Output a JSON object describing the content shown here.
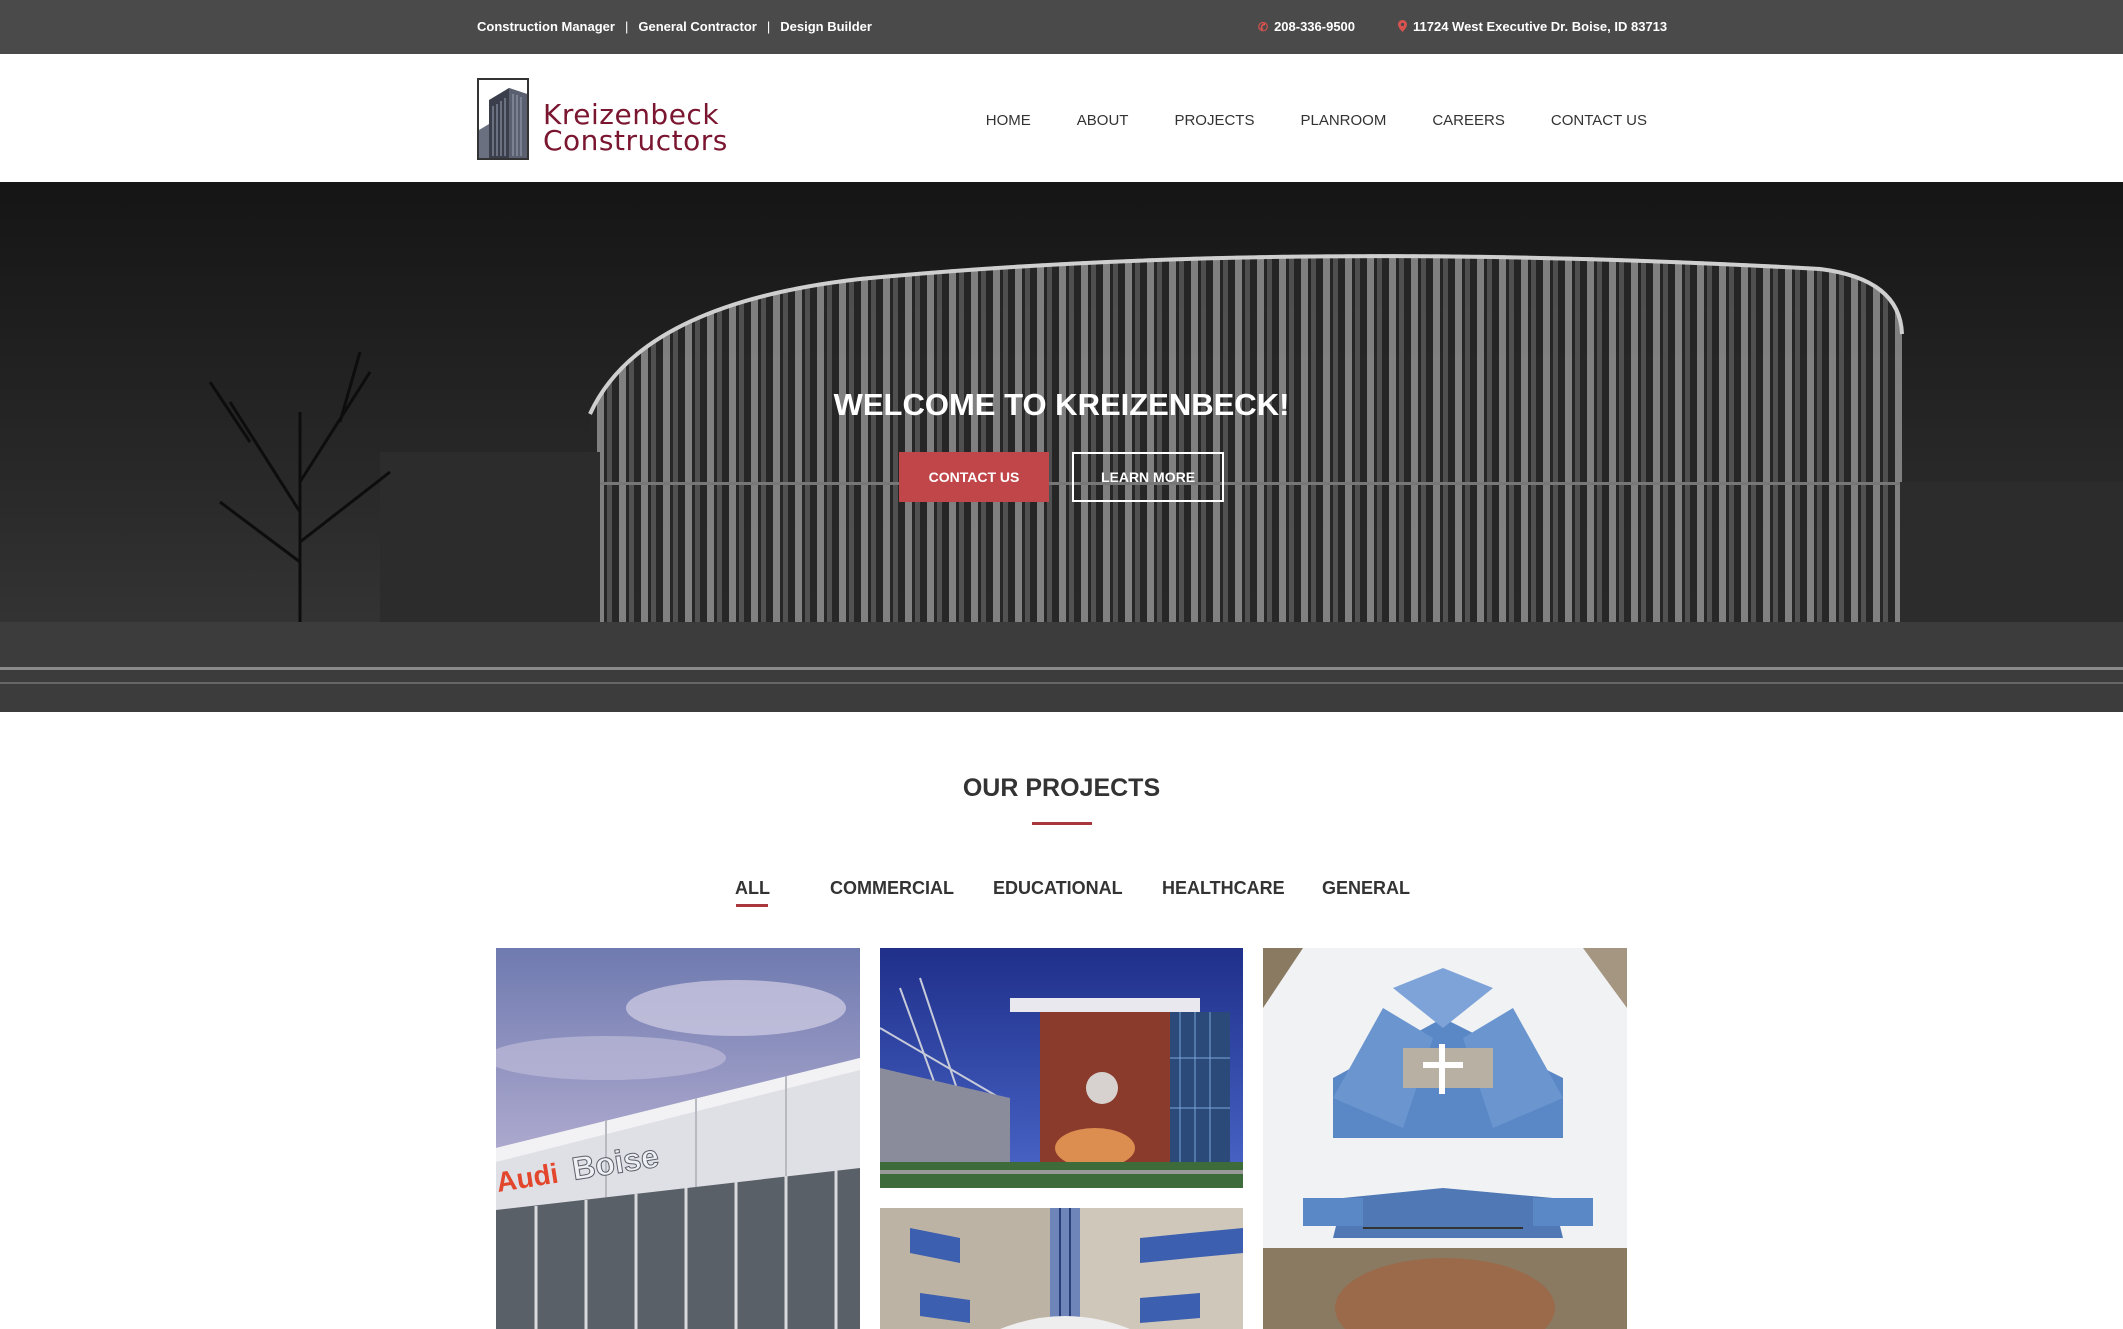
{
  "topbar": {
    "tags": [
      "Construction Manager",
      "General Contractor",
      "Design Builder"
    ],
    "separator": "|",
    "phone": "208-336-9500",
    "address": "11724 West Executive Dr. Boise, ID 83713"
  },
  "logo": {
    "line1": "Kreizenbeck",
    "line2": "Constructors"
  },
  "nav": [
    "HOME",
    "ABOUT",
    "PROJECTS",
    "PLANROOM",
    "CAREERS",
    "CONTACT US"
  ],
  "hero": {
    "title": "WELCOME TO KREIZENBECK!",
    "contact_label": "CONTACT US",
    "learn_label": "LEARN MORE"
  },
  "projects": {
    "title": "OUR PROJECTS",
    "filters": [
      "ALL",
      "COMMERCIAL",
      "EDUCATIONAL",
      "HEALTHCARE",
      "GENERAL"
    ],
    "active_filter": "ALL",
    "audi_sign": "Audi",
    "boise_sign": "Boise"
  },
  "colors": {
    "accent": "#c0464a",
    "brand": "#7b1631",
    "topbar": "#4a4a4a"
  }
}
